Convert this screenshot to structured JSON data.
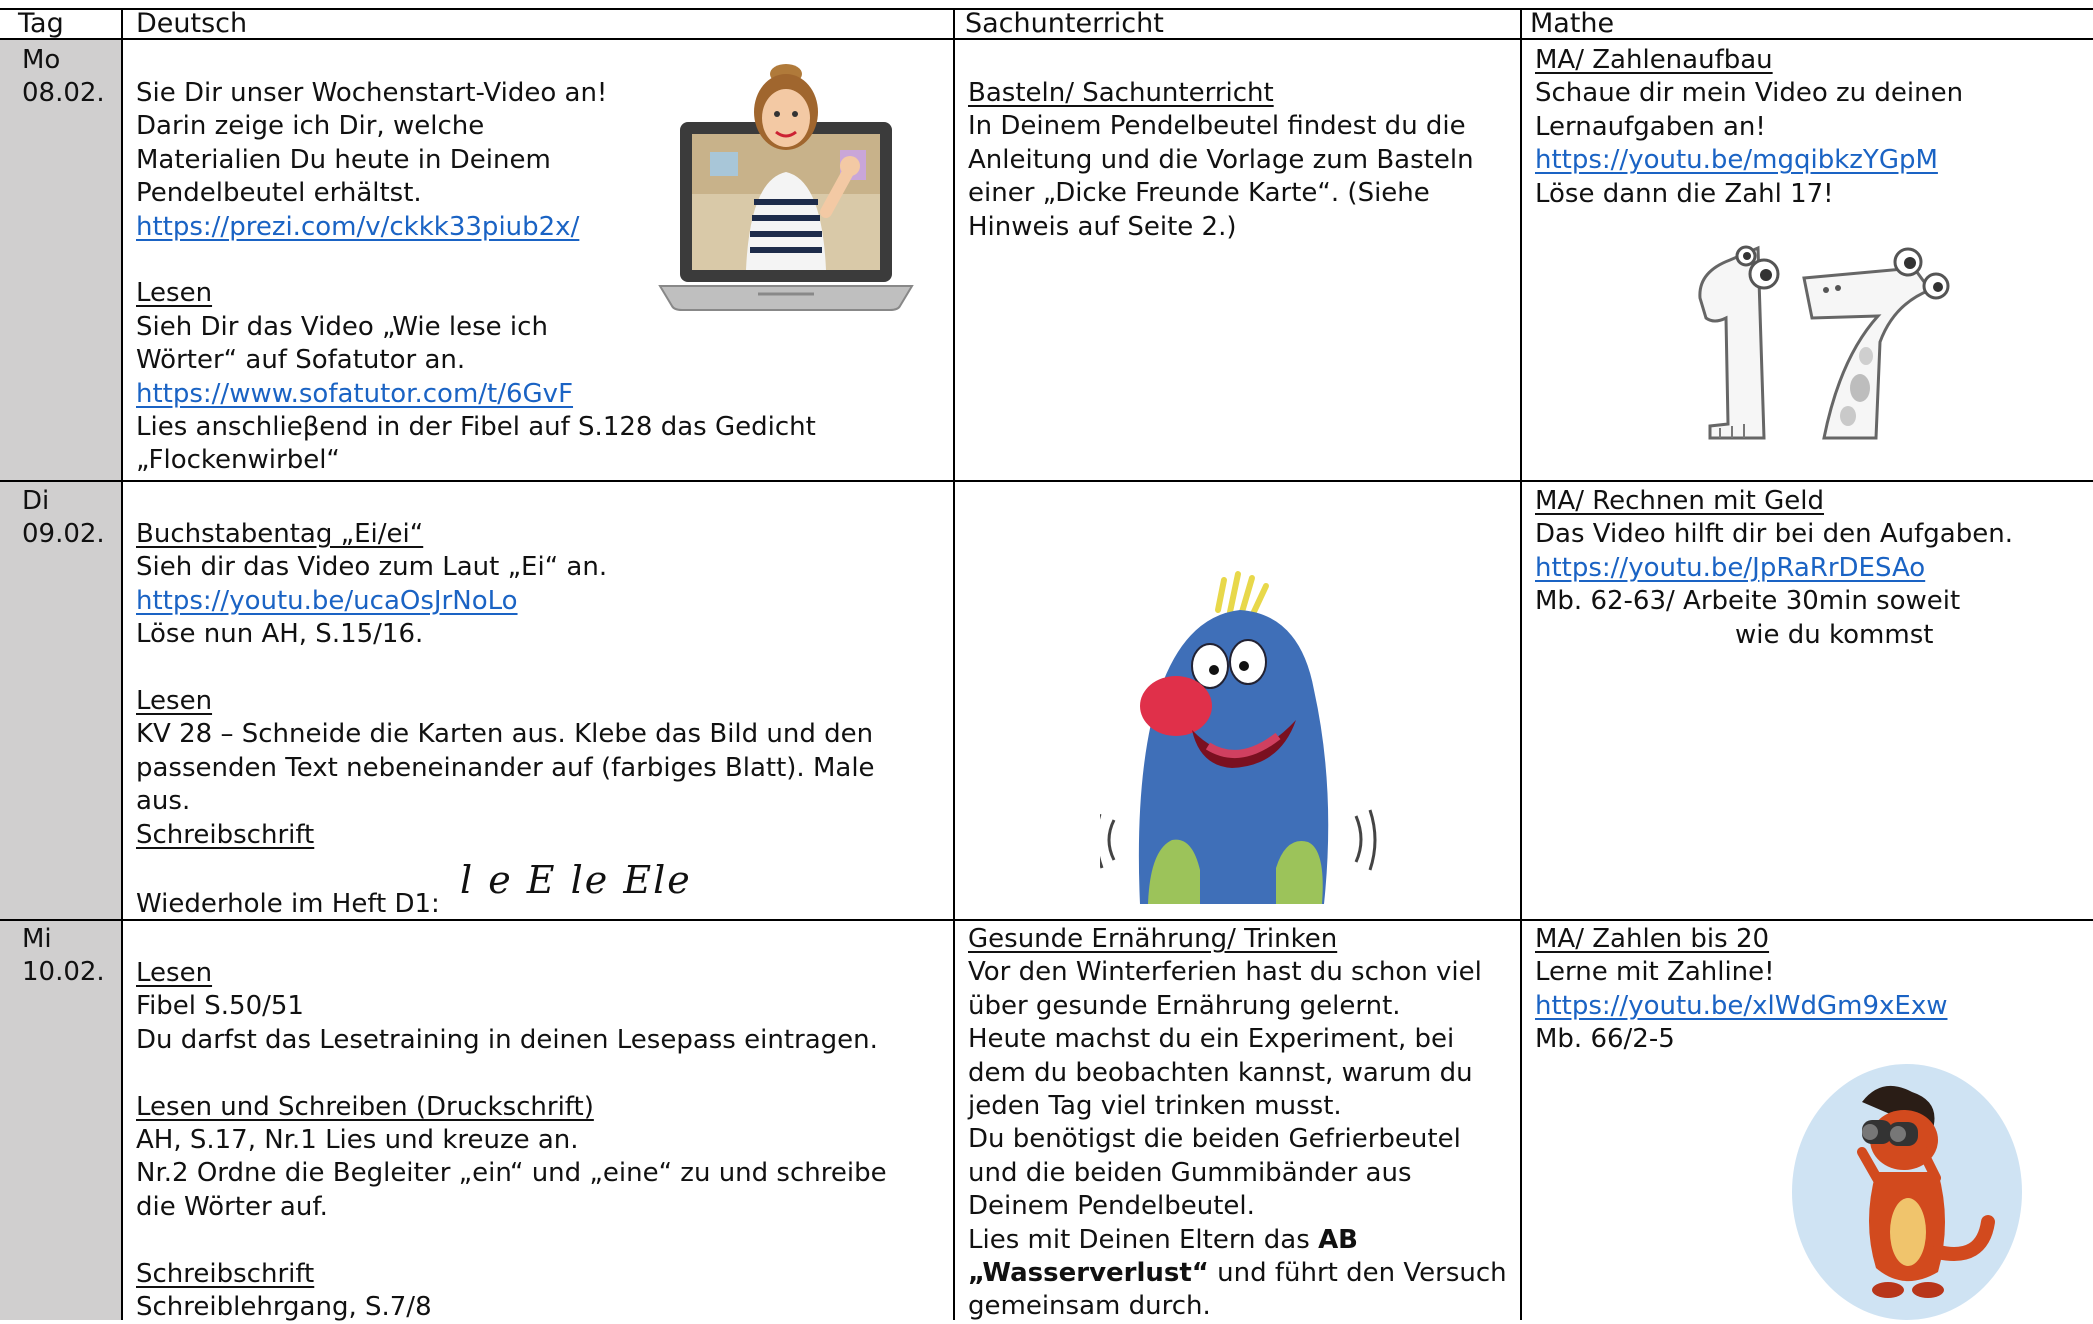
{
  "header": {
    "tag": "Tag",
    "deutsch": "Deutsch",
    "sachunterricht": "Sachunterricht",
    "mathe": "Mathe"
  },
  "rows": [
    {
      "day": "Mo",
      "date": "08.02.",
      "deutsch": {
        "intro": [
          "Sie Dir unser Wochenstart-Video an!",
          "Darin zeige ich Dir, welche",
          "Materialien Du heute in Deinem",
          "Pendelbeutel erhältst."
        ],
        "link1": "https://prezi.com/v/ckkk33piub2x/",
        "heading2": "Lesen",
        "text2": [
          "Sieh Dir das Video „Wie lese ich",
          "Wörter“ auf Sofatutor an."
        ],
        "link2": "https://www.sofatutor.com/t/6GvF",
        "text3": [
          "Lies anschlieβend in der Fibel auf S.128 das Gedicht",
          "„Flockenwirbel“"
        ]
      },
      "sach": {
        "heading": "Basteln/ Sachunterricht",
        "text": [
          "In Deinem Pendelbeutel findest du die",
          "Anleitung und die Vorlage zum Basteln",
          "einer „Dicke Freunde Karte“. (Siehe",
          "Hinweis auf Seite 2.)"
        ]
      },
      "mathe": {
        "heading": "MA/ Zahlenaufbau",
        "text": [
          "Schaue dir mein Video zu deinen",
          "Lernaufgaben an!"
        ],
        "link": "https://youtu.be/mgqibkzYGpM",
        "after": "Löse dann die Zahl 17!"
      }
    },
    {
      "day": "Di",
      "date": "09.02.",
      "deutsch": {
        "heading1": "Buchstabentag „Ei/ei“",
        "text1": "Sieh dir das Video zum Laut „Ei“ an.",
        "link1": "https://youtu.be/ucaOsJrNoLo",
        "text1b": "Löse nun AH, S.15/16.",
        "heading2": "Lesen",
        "text2": [
          "KV 28 – Schneide die Karten aus. Klebe das Bild und den",
          "passenden Text nebeneinander auf (farbiges Blatt). Male",
          "aus."
        ],
        "heading3": "Schreibschrift",
        "text3": "Wiederhole im Heft D1:",
        "script": "l e E le Ele"
      },
      "mathe": {
        "heading": "MA/ Rechnen mit Geld",
        "text": "Das Video hilft dir bei den Aufgaben.",
        "link": "https://youtu.be/JpRaRrDESAo",
        "after": [
          "Mb. 62-63/ Arbeite 30min soweit",
          "wie du kommst"
        ]
      }
    },
    {
      "day": "Mi",
      "date": "10.02.",
      "deutsch": {
        "heading1": "Lesen",
        "text1": [
          "Fibel S.50/51",
          "Du darfst das Lesetraining in deinen Lesepass eintragen."
        ],
        "heading2": "Lesen und Schreiben (Druckschrift)",
        "text2": [
          "AH, S.17, Nr.1 Lies und kreuze an.",
          "Nr.2 Ordne die Begleiter „ein“ und „eine“ zu und schreibe",
          "die Wörter auf."
        ],
        "heading3": "Schreibschrift",
        "text3": "Schreiblehrgang, S.7/8"
      },
      "sach": {
        "heading": "Gesunde Ernährung/ Trinken",
        "text": [
          "Vor den Winterferien hast du schon viel",
          "über gesunde Ernährung gelernt.",
          "Heute machst du ein Experiment, bei",
          "dem du beobachten kannst, warum du",
          "jeden Tag viel trinken musst.",
          "Du benötigst die beiden Gefrierbeutel",
          "und die beiden Gummibänder aus",
          "Deinem Pendelbeutel."
        ],
        "text_pre_bold": "Lies mit Deinen Eltern das ",
        "bold1": "AB",
        "bold2": "„Wasserverlust“",
        "text_post_bold": " und führt den Versuch",
        "last": "gemeinsam durch."
      },
      "mathe": {
        "heading": "MA/ Zahlen bis 20",
        "text": "Lerne mit Zahline!",
        "link": "https://youtu.be/xlWdGm9xExw",
        "after": "Mb. 66/2-5"
      }
    }
  ]
}
